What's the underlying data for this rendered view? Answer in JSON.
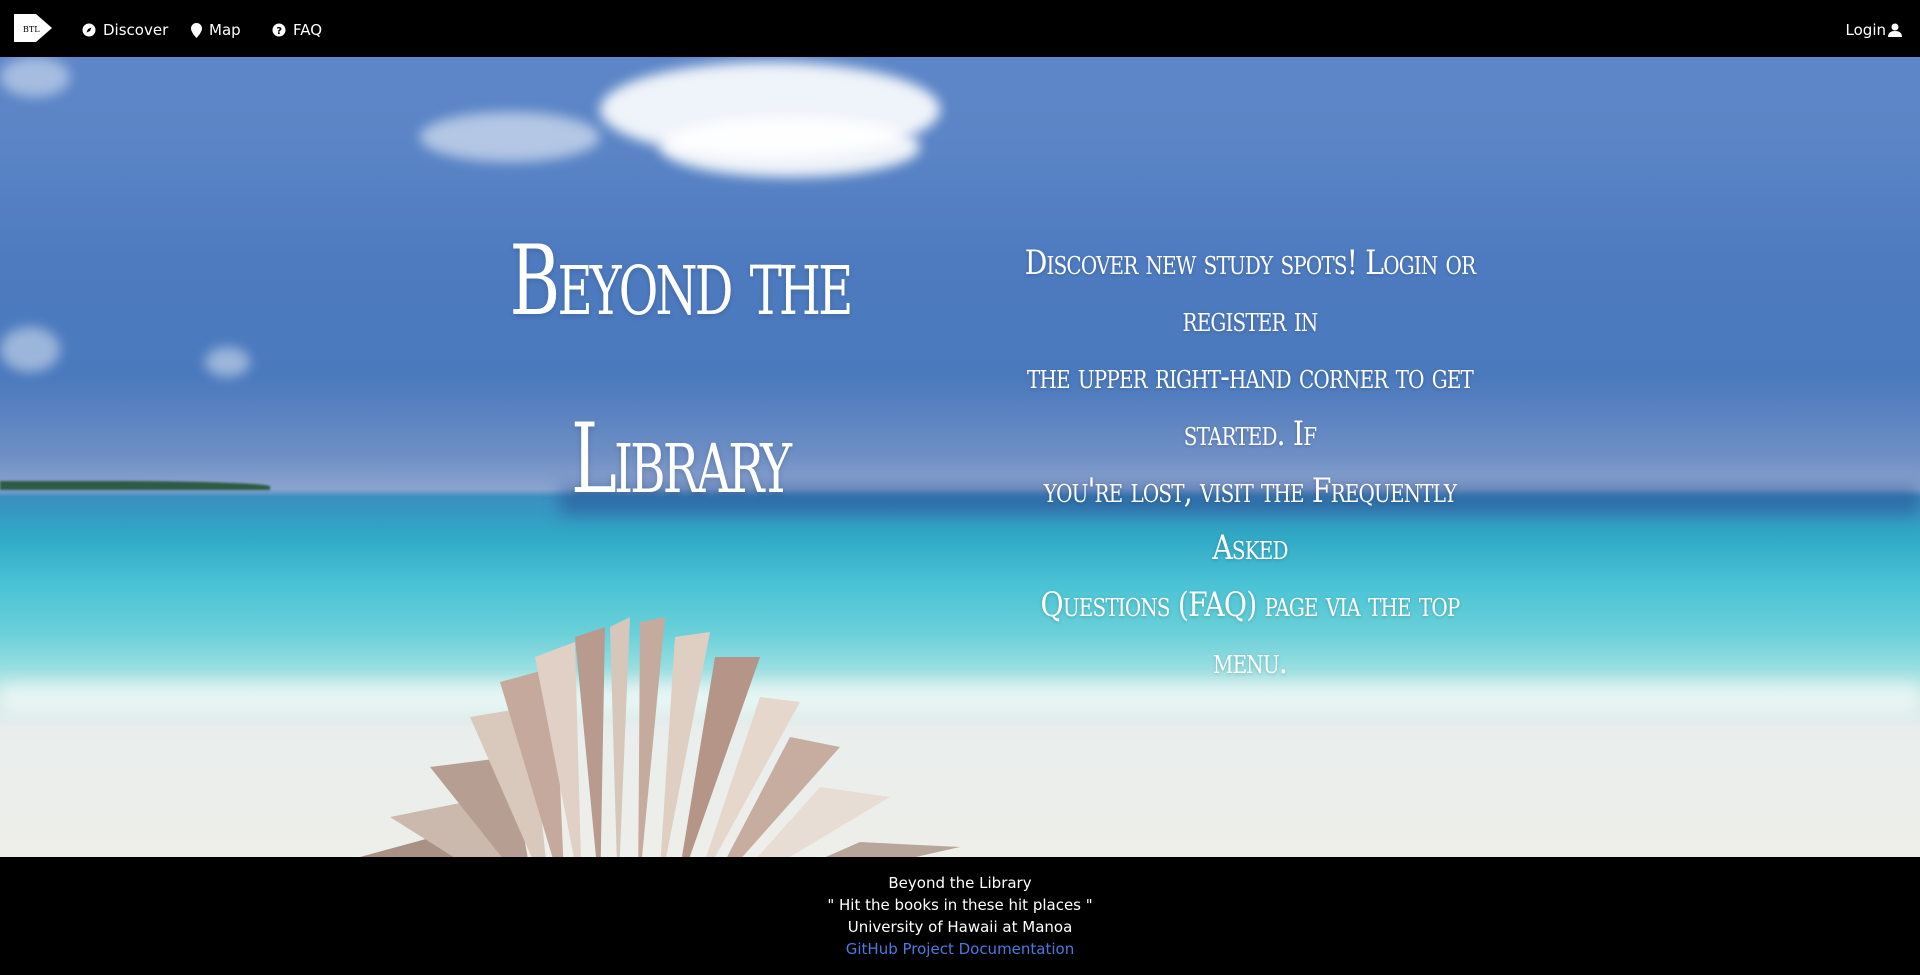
{
  "nav": {
    "logo_text": "BTL",
    "items": [
      {
        "label": "Discover",
        "icon": "compass-icon"
      },
      {
        "label": "Map",
        "icon": "map-pin-icon"
      },
      {
        "label": "FAQ",
        "icon": "question-circle-icon"
      }
    ],
    "login_label": "Login",
    "login_icon": "user-icon"
  },
  "hero": {
    "title_line1": "Beyond the",
    "title_line2": "Library",
    "description_lines": [
      "Discover new study spots! Login or register in",
      "the upper right-hand corner to get started. If",
      "you're lost, visit the Frequently Asked",
      "Questions (FAQ) page via the top menu."
    ]
  },
  "footer": {
    "name": "Beyond the Library",
    "tagline": "\" Hit the books in these hit places \"",
    "university": "University of Hawaii at Manoa",
    "link_label": "GitHub Project Documentation",
    "link_color": "#4a7be0"
  },
  "colors": {
    "bar_background": "#000000",
    "text": "#ffffff"
  }
}
